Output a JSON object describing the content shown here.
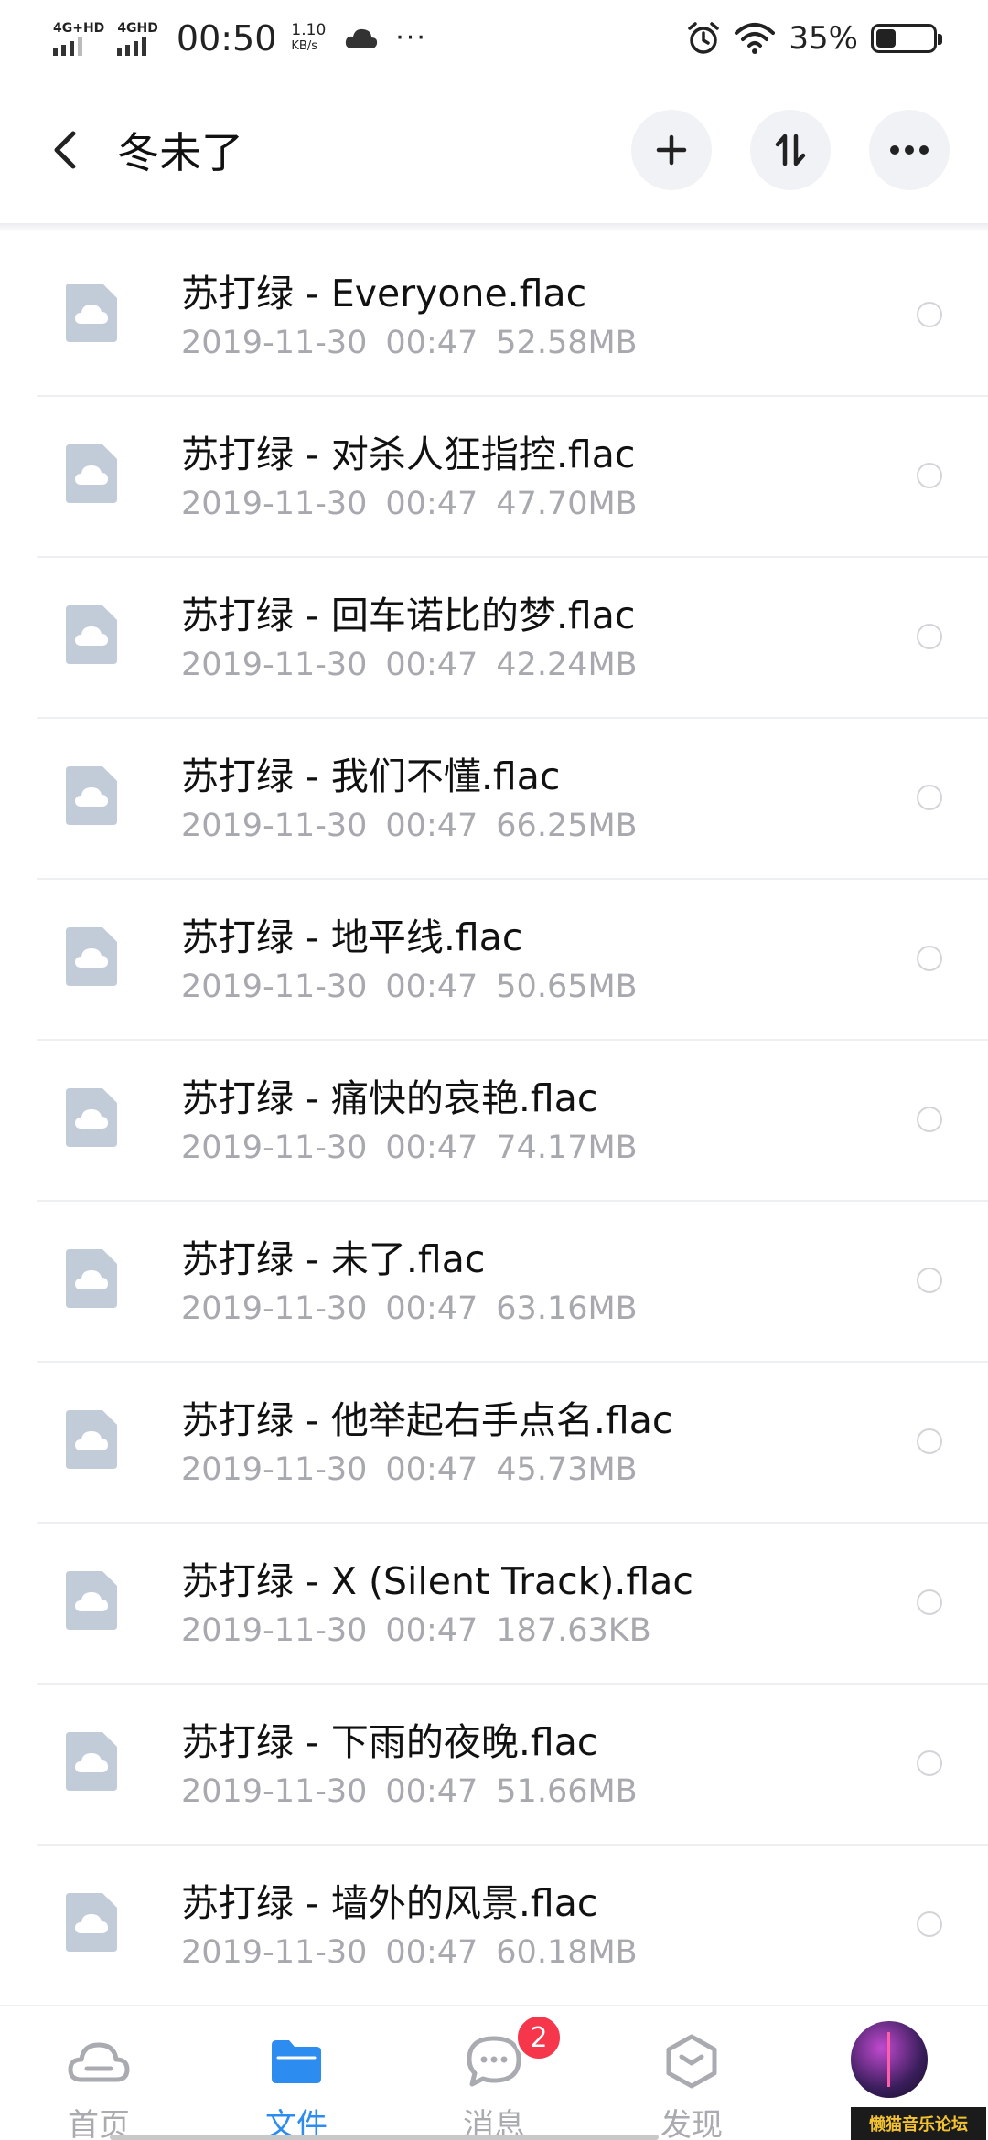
{
  "status_bar": {
    "signal1": "4G+HD",
    "signal2": "4GHD",
    "time": "00:50",
    "speed_value": "1.10",
    "speed_unit": "KB/s",
    "more": "···",
    "battery_pct": "35%",
    "battery_level": 0.35,
    "icons": [
      "cloud-icon",
      "alarm-icon",
      "wifi-icon",
      "battery-icon"
    ]
  },
  "header": {
    "title": "冬未了",
    "icons": [
      "back-icon",
      "plus-icon",
      "sort-icon",
      "more-icon"
    ]
  },
  "files": [
    {
      "name": "苏打绿 - Everyone.flac",
      "date": "2019-11-30",
      "time": "00:47",
      "size": "52.58MB"
    },
    {
      "name": "苏打绿 - 对杀人狂指控.flac",
      "date": "2019-11-30",
      "time": "00:47",
      "size": "47.70MB"
    },
    {
      "name": "苏打绿 - 回车诺比的梦.flac",
      "date": "2019-11-30",
      "time": "00:47",
      "size": "42.24MB"
    },
    {
      "name": "苏打绿 - 我们不懂.flac",
      "date": "2019-11-30",
      "time": "00:47",
      "size": "66.25MB"
    },
    {
      "name": "苏打绿 - 地平线.flac",
      "date": "2019-11-30",
      "time": "00:47",
      "size": "50.65MB"
    },
    {
      "name": "苏打绿 - 痛快的哀艳.flac",
      "date": "2019-11-30",
      "time": "00:47",
      "size": "74.17MB"
    },
    {
      "name": "苏打绿 - 未了.flac",
      "date": "2019-11-30",
      "time": "00:47",
      "size": "63.16MB"
    },
    {
      "name": "苏打绿 - 他举起右手点名.flac",
      "date": "2019-11-30",
      "time": "00:47",
      "size": "45.73MB"
    },
    {
      "name": "苏打绿 - X (Silent Track).flac",
      "date": "2019-11-30",
      "time": "00:47",
      "size": "187.63KB"
    },
    {
      "name": "苏打绿 - 下雨的夜晚.flac",
      "date": "2019-11-30",
      "time": "00:47",
      "size": "51.66MB"
    },
    {
      "name": "苏打绿 - 墙外的风景.flac",
      "date": "2019-11-30",
      "time": "00:47",
      "size": "60.18MB"
    }
  ],
  "bottom_nav": {
    "tabs": [
      {
        "label": "首页",
        "icon": "cloud-home-icon",
        "active": false
      },
      {
        "label": "文件",
        "icon": "folder-icon",
        "active": true
      },
      {
        "label": "消息",
        "icon": "chat-icon",
        "active": false,
        "badge": "2"
      },
      {
        "label": "发现",
        "icon": "discover-icon",
        "active": false
      },
      {
        "label": "",
        "icon": "avatar",
        "active": false
      }
    ],
    "watermark": "懒猫音乐论坛"
  },
  "colors": {
    "accent": "#2d8cf0",
    "badge": "#f5364b",
    "file_icon": "#c2ccd9",
    "meta_text": "#a7a9ae"
  }
}
